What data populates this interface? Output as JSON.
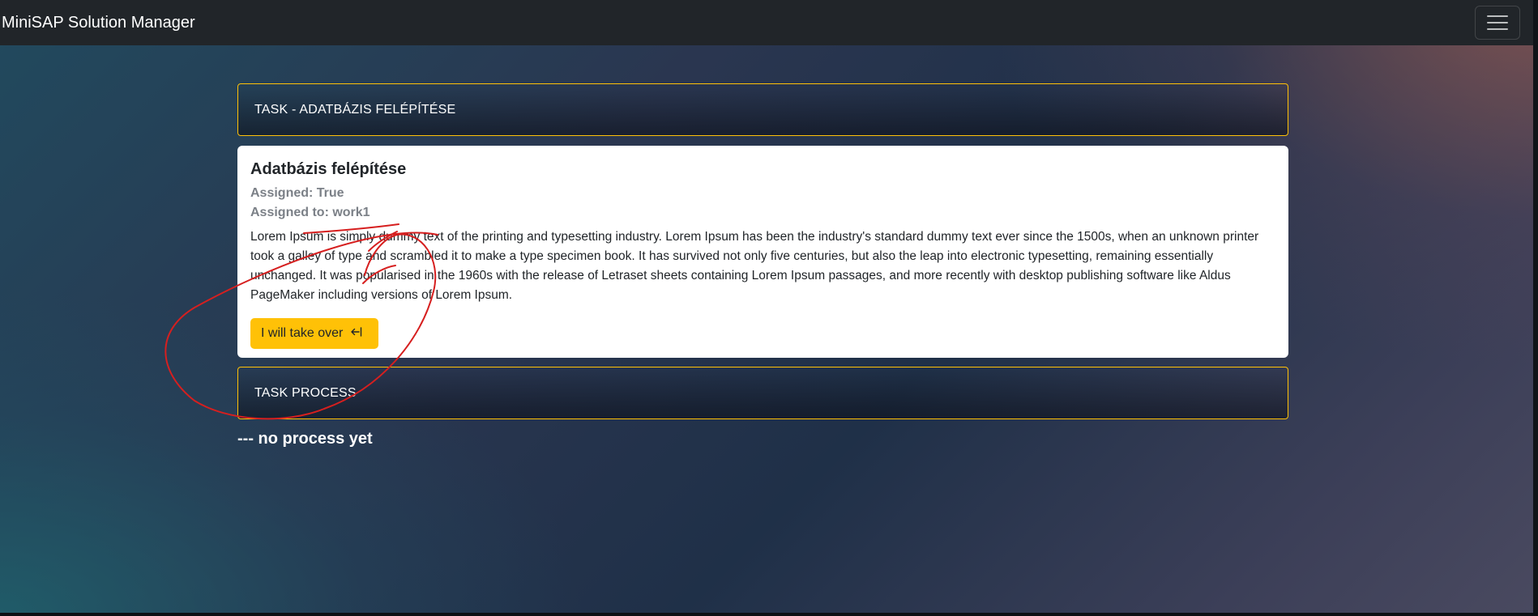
{
  "navbar": {
    "brand": "MiniSAP Solution Manager",
    "toggler_icon": "hamburger-menu-icon"
  },
  "task_header": {
    "title": "TASK - ADATBÁZIS FELÉPÍTÉSE"
  },
  "task": {
    "name": "Adatbázis felépítése",
    "assigned": "Assigned: True",
    "assigned_to": "Assigned to: work1",
    "description": "Lorem Ipsum is simply dummy text of the printing and typesetting industry. Lorem Ipsum has been the industry's standard dummy text ever since the 1500s, when an unknown printer took a galley of type and scrambled it to make a type specimen book. It has survived not only five centuries, but also the leap into electronic typesetting, remaining essentially unchanged. It was popularised in the 1960s with the release of Letraset sheets containing Lorem Ipsum passages, and more recently with desktop publishing software like Aldus PageMaker including versions of Lorem Ipsum.",
    "take_over_label": "I will take over",
    "take_over_icon": "enter-arrow-icon"
  },
  "process_header": {
    "title": "TASK PROCESS"
  },
  "process": {
    "empty_text": "--- no process yet"
  },
  "colors": {
    "navbar_bg": "#212529",
    "accent_yellow": "#ffc107",
    "annotation_red": "#d61f1f"
  }
}
